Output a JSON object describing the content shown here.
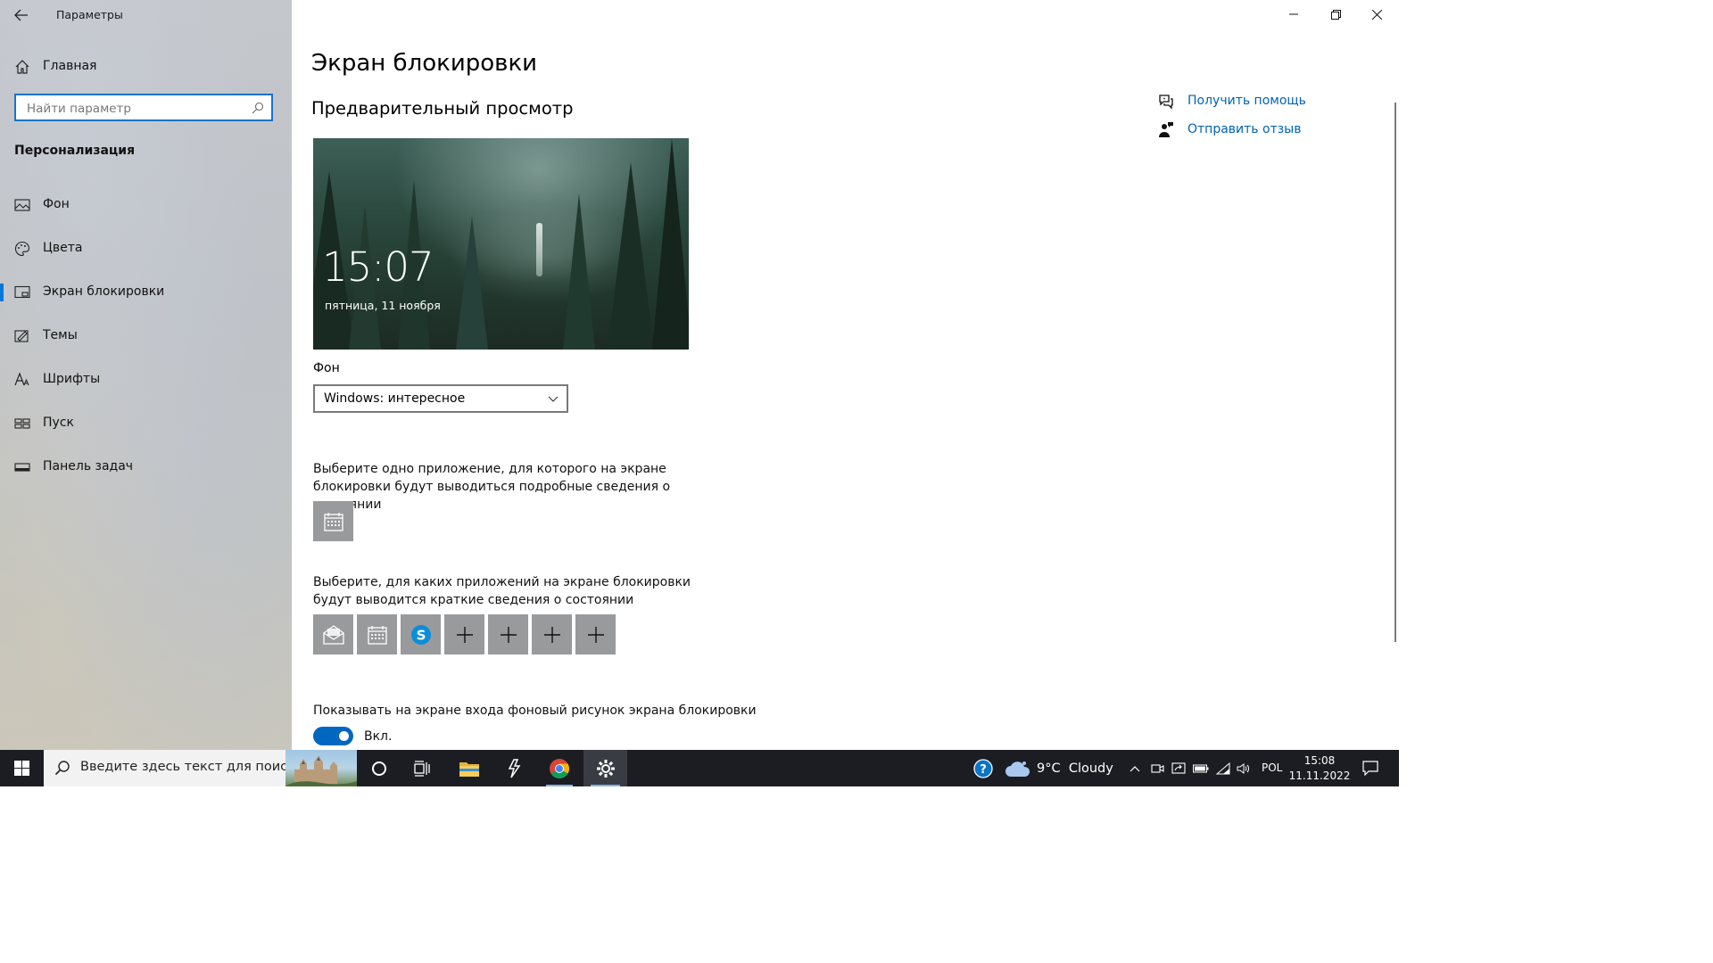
{
  "app": {
    "title": "Параметры"
  },
  "sidebar": {
    "home_label": "Главная",
    "search_placeholder": "Найти параметр",
    "section_title": "Персонализация",
    "items": [
      {
        "label": "Фон",
        "icon": "picture-icon"
      },
      {
        "label": "Цвета",
        "icon": "palette-icon"
      },
      {
        "label": "Экран блокировки",
        "icon": "lock-screen-icon",
        "active": true
      },
      {
        "label": "Темы",
        "icon": "themes-icon"
      },
      {
        "label": "Шрифты",
        "icon": "fonts-icon"
      },
      {
        "label": "Пуск",
        "icon": "start-icon"
      },
      {
        "label": "Панель задач",
        "icon": "taskbar-icon"
      }
    ]
  },
  "main": {
    "title": "Экран блокировки",
    "preview_title": "Предварительный просмотр",
    "preview": {
      "time": "15:07",
      "date": "пятница, 11 ноября"
    },
    "background_label": "Фон",
    "background_value": "Windows: интересное",
    "detailed_status_desc": "Выберите одно приложение, для которого на экране блокировки будут выводиться подробные сведения о состоянии",
    "quick_status_desc": "Выберите, для каких приложений на экране блокировки будут выводится краткие сведения о состоянии",
    "quick_status_apps": [
      "mail-icon",
      "calendar-icon",
      "skype-icon",
      "add-icon",
      "add-icon",
      "add-icon",
      "add-icon"
    ],
    "signin_bg_label": "Показывать на экране входа фоновый рисунок экрана блокировки",
    "signin_bg_state": "Вкл."
  },
  "help": {
    "get_help": "Получить помощь",
    "feedback": "Отправить отзыв"
  },
  "taskbar": {
    "search_placeholder": "Введите здесь текст для поиска",
    "weather": "9°C  Cloudy",
    "lang": "POL",
    "time": "15:08",
    "date": "11.11.2022"
  },
  "colors": {
    "accent": "#0078d7",
    "link": "#0063b1",
    "taskbar": "#1b1d22"
  }
}
